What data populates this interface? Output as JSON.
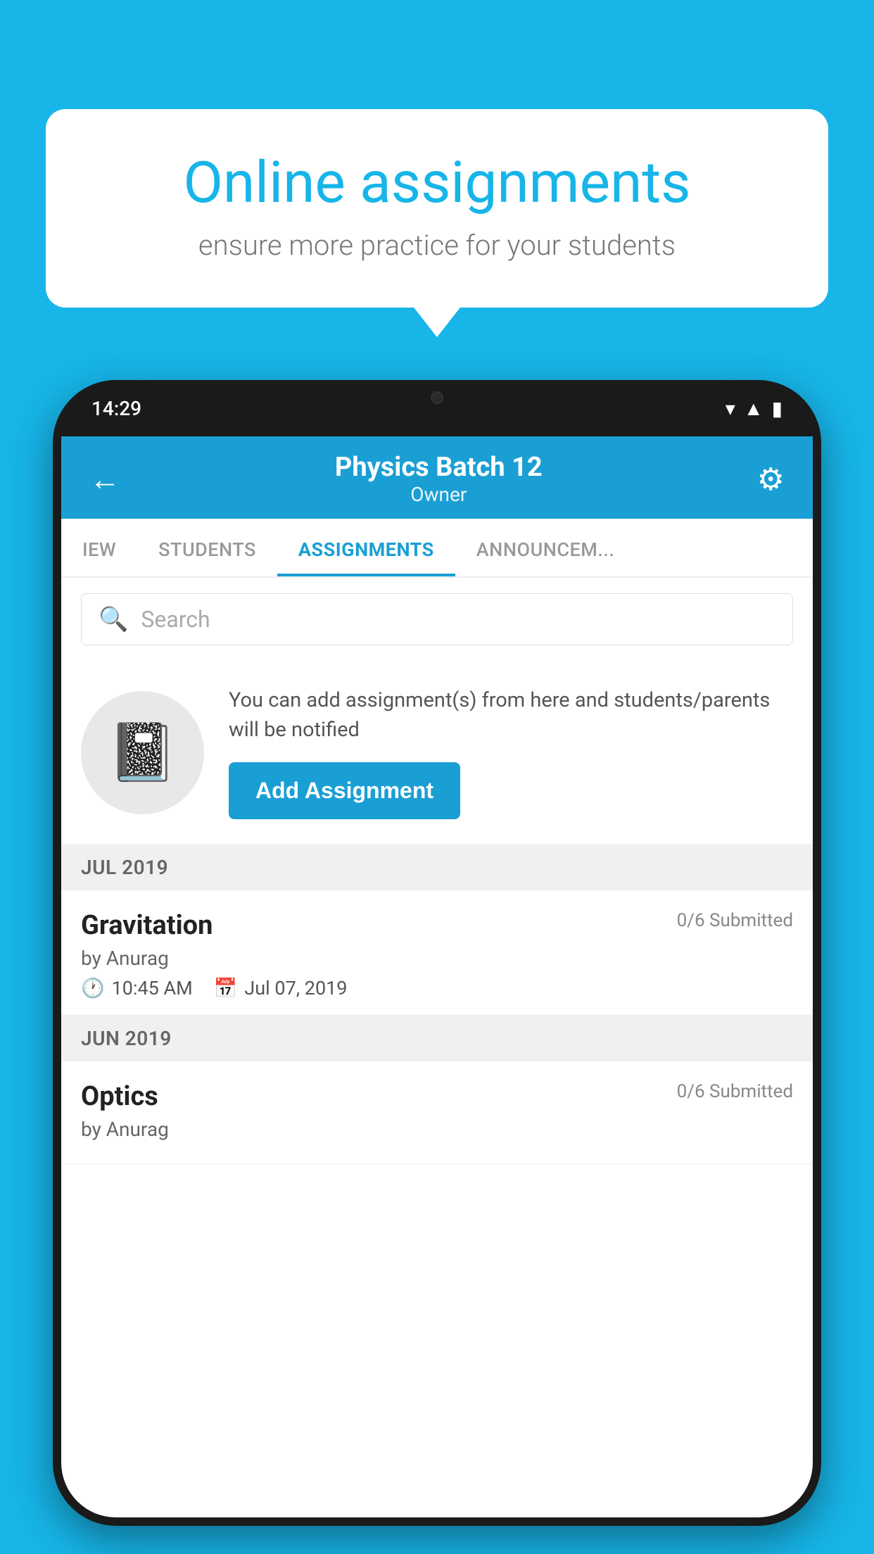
{
  "background_color": "#17b5e8",
  "speech_bubble": {
    "title": "Online assignments",
    "subtitle": "ensure more practice for your students"
  },
  "phone": {
    "status_bar": {
      "time": "14:29"
    },
    "header": {
      "title": "Physics Batch 12",
      "subtitle": "Owner",
      "back_label": "←",
      "settings_label": "⚙"
    },
    "tabs": [
      {
        "label": "IEW",
        "active": false
      },
      {
        "label": "STUDENTS",
        "active": false
      },
      {
        "label": "ASSIGNMENTS",
        "active": true
      },
      {
        "label": "ANNOUNCEM...",
        "active": false
      }
    ],
    "search": {
      "placeholder": "Search"
    },
    "add_assignment": {
      "description": "You can add assignment(s) from here and students/parents will be notified",
      "button_label": "Add Assignment"
    },
    "sections": [
      {
        "label": "JUL 2019",
        "assignments": [
          {
            "name": "Gravitation",
            "submitted": "0/6 Submitted",
            "by": "by Anurag",
            "time": "10:45 AM",
            "date": "Jul 07, 2019"
          }
        ]
      },
      {
        "label": "JUN 2019",
        "assignments": [
          {
            "name": "Optics",
            "submitted": "0/6 Submitted",
            "by": "by Anurag",
            "time": "",
            "date": ""
          }
        ]
      }
    ]
  }
}
